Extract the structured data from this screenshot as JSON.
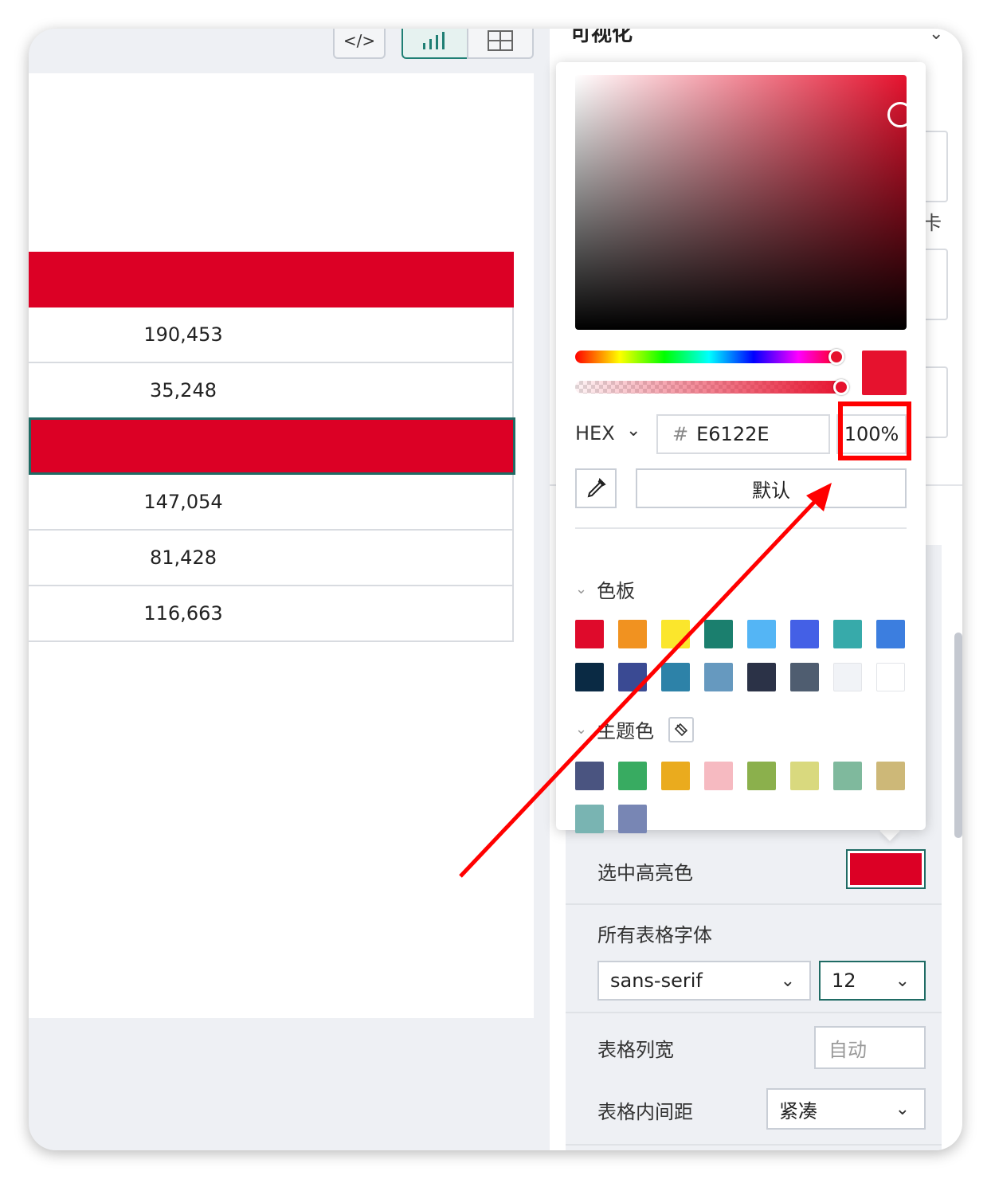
{
  "toolbar": {
    "code_icon": "code-icon",
    "chart_icon": "bar-chart-icon",
    "table_icon": "table-icon"
  },
  "table": {
    "rows": [
      {
        "value": "",
        "highlight": true
      },
      {
        "value": "190,453"
      },
      {
        "value": "35,248"
      },
      {
        "value": "",
        "highlight": true,
        "selected": true
      },
      {
        "value": "147,054"
      },
      {
        "value": "81,428"
      },
      {
        "value": "116,663"
      }
    ],
    "highlight_color": "#dc0025"
  },
  "right_panel": {
    "title": "可视化",
    "side_char": "卡",
    "highlight_label": "选中高亮色",
    "font_label": "所有表格字体",
    "font_family": "sans-serif",
    "font_size": "12",
    "col_width_label": "表格列宽",
    "col_width_placeholder": "自动",
    "padding_label": "表格内间距",
    "padding_value": "紧凑"
  },
  "color_picker": {
    "mode": "HEX",
    "hash": "#",
    "hex_value": "E6122E",
    "alpha": "100%",
    "default_label": "默认",
    "palette_title": "色板",
    "theme_title": "主题色",
    "current_color": "#e6122e",
    "palette": [
      "#df0a2b",
      "#f19220",
      "#fbe62c",
      "#1b7f6e",
      "#54b5f5",
      "#4460e6",
      "#37aaaa",
      "#3c7edf",
      "#0a2a44",
      "#3a4a93",
      "#2d82a8",
      "#6699bf",
      "#2b3247",
      "#4f5d70",
      "#f1f3f7",
      "#ffffff"
    ],
    "theme": [
      "#4a5480",
      "#38ab61",
      "#eaab1e",
      "#f6bac1",
      "#8bb04c",
      "#d9d97e",
      "#7fb99d",
      "#cdb878",
      "#79b4b2",
      "#7886b4"
    ]
  }
}
